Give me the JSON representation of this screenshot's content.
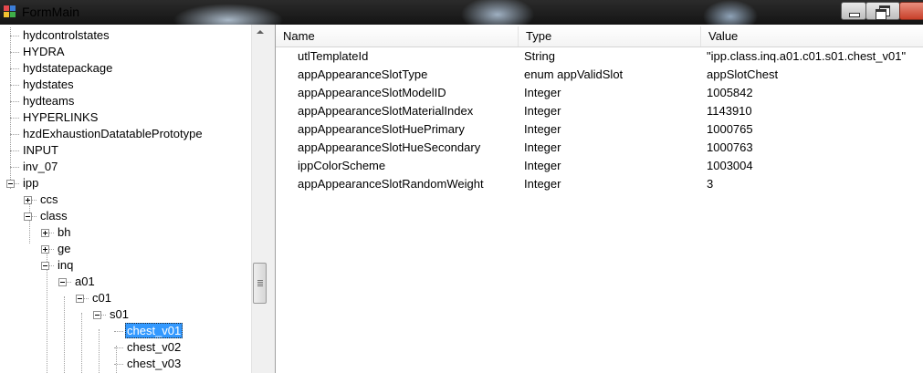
{
  "window": {
    "title": "FormMain"
  },
  "tree": {
    "nodes": [
      {
        "label": "hydcontrolstates",
        "expander": "none"
      },
      {
        "label": "HYDRA",
        "expander": "none"
      },
      {
        "label": "hydstatepackage",
        "expander": "none"
      },
      {
        "label": "hydstates",
        "expander": "none"
      },
      {
        "label": "hydteams",
        "expander": "none"
      },
      {
        "label": "HYPERLINKS",
        "expander": "none"
      },
      {
        "label": "hzdExhaustionDatatablePrototype",
        "expander": "none"
      },
      {
        "label": "INPUT",
        "expander": "none"
      },
      {
        "label": "inv_07",
        "expander": "none"
      },
      {
        "label": "ipp",
        "expander": "expanded"
      },
      {
        "label": "ccs",
        "expander": "collapsed"
      },
      {
        "label": "class",
        "expander": "expanded"
      },
      {
        "label": "bh",
        "expander": "collapsed"
      },
      {
        "label": "ge",
        "expander": "collapsed"
      },
      {
        "label": "inq",
        "expander": "expanded"
      },
      {
        "label": "a01",
        "expander": "expanded"
      },
      {
        "label": "c01",
        "expander": "expanded"
      },
      {
        "label": "s01",
        "expander": "expanded"
      },
      {
        "label": "chest_v01",
        "expander": "none",
        "selected": true
      },
      {
        "label": "chest_v02",
        "expander": "none"
      },
      {
        "label": "chest_v03",
        "expander": "none"
      }
    ]
  },
  "grid": {
    "columns": [
      "Name",
      "Type",
      "Value"
    ],
    "rows": [
      {
        "name": "utlTemplateId",
        "type": "String",
        "value": "\"ipp.class.inq.a01.c01.s01.chest_v01\""
      },
      {
        "name": "appAppearanceSlotType",
        "type": "enum appValidSlot",
        "value": "appSlotChest"
      },
      {
        "name": "appAppearanceSlotModelID",
        "type": "Integer",
        "value": "1005842"
      },
      {
        "name": "appAppearanceSlotMaterialIndex",
        "type": "Integer",
        "value": "1143910"
      },
      {
        "name": "appAppearanceSlotHuePrimary",
        "type": "Integer",
        "value": "1000765"
      },
      {
        "name": "appAppearanceSlotHueSecondary",
        "type": "Integer",
        "value": "1000763"
      },
      {
        "name": "ippColorScheme",
        "type": "Integer",
        "value": "1003004"
      },
      {
        "name": "appAppearanceSlotRandomWeight",
        "type": "Integer",
        "value": "3"
      }
    ]
  },
  "colors": {
    "selection": "#3399ff",
    "titlebar": "#1e1e1e"
  },
  "icons": [
    "app-icon",
    "minimize-icon",
    "maximize-icon",
    "close-icon",
    "scroll-up-icon"
  ]
}
